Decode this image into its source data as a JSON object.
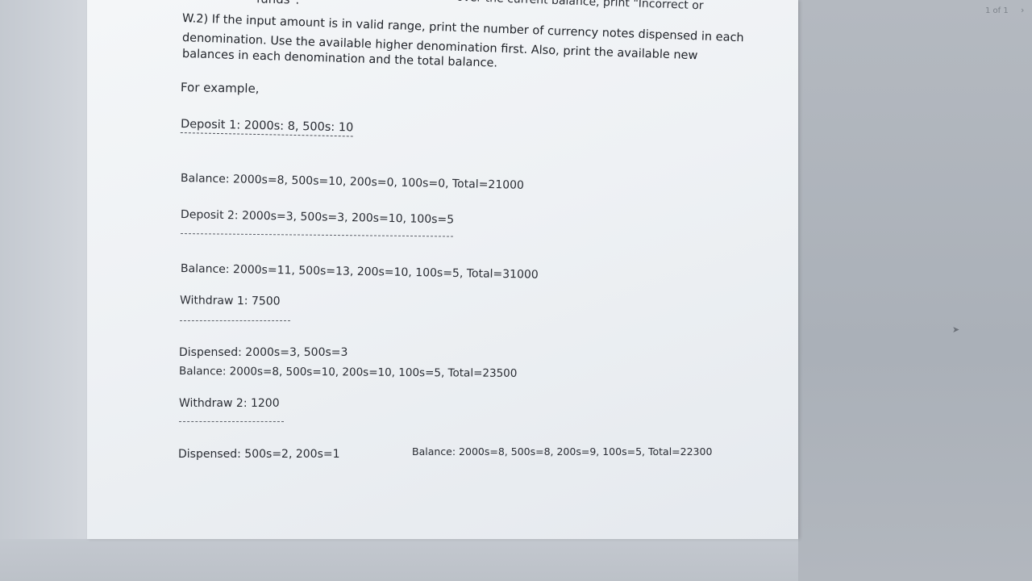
{
  "document": {
    "top_fragment_left": "funds\".",
    "top_fragment_right": "over the current balance, print \"Incorrect or",
    "w2_line1": "W.2) If the input amount is in valid range, print the number of currency notes dispensed in each",
    "w2_line2": "denomination. Use the available higher denomination first. Also, print the available new",
    "w2_line3": "balances in each denomination and the total balance.",
    "for_example": "For example,",
    "deposit1": "Deposit 1: 2000s: 8, 500s: 10",
    "balance1": "Balance: 2000s=8, 500s=10, 200s=0, 100s=0, Total=21000",
    "deposit2": "Deposit 2: 2000s=3, 500s=3, 200s=10, 100s=5",
    "balance2": "Balance: 2000s=11, 500s=13, 200s=10, 100s=5, Total=31000",
    "withdraw1": "Withdraw 1: 7500",
    "dispensed1": "Dispensed: 2000s=3, 500s=3",
    "balance3": "Balance: 2000s=8, 500s=10, 200s=10, 100s=5, Total=23500",
    "withdraw2": "Withdraw 2: 1200",
    "dispensed2": "Dispensed: 500s=2, 200s=1",
    "balance4": "Balance: 2000s=8, 500s=8, 200s=9, 100s=5, Total=22300"
  },
  "viewer": {
    "page_counter": "1 of 1",
    "next_page_icon": "chevron-right-icon",
    "cursor_icon": "arrow-cursor-icon"
  }
}
